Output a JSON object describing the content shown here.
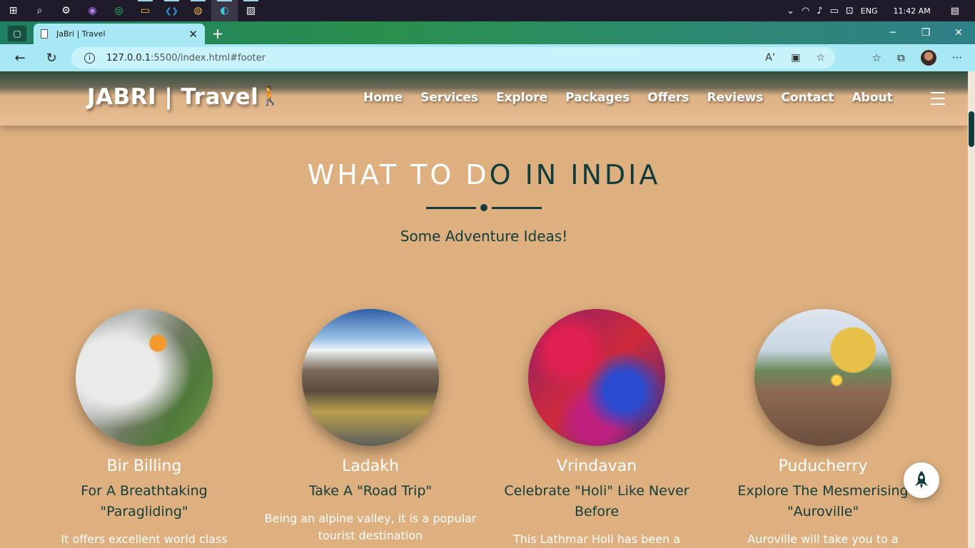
{
  "taskbar": {
    "apps": [
      {
        "icon": "windows-start-icon",
        "glyph": "⊞"
      },
      {
        "icon": "search-icon",
        "glyph": "⌕"
      },
      {
        "icon": "settings-gear-icon",
        "glyph": "⚙"
      },
      {
        "icon": "github-desktop-icon",
        "glyph": "◉"
      },
      {
        "icon": "spotify-icon",
        "glyph": "◎"
      },
      {
        "icon": "file-explorer-icon",
        "glyph": "▭"
      },
      {
        "icon": "vscode-icon",
        "glyph": "❮❯"
      },
      {
        "icon": "chrome-icon",
        "glyph": "◍"
      },
      {
        "icon": "edge-icon",
        "glyph": "◐"
      },
      {
        "icon": "photos-icon",
        "glyph": "▨"
      }
    ],
    "language": "ENG",
    "time": "11:42 AM"
  },
  "browser": {
    "tab_title": "JaBri | Travel",
    "url_host": "127.0.0.1",
    "url_path": ":5500/index.html#footer"
  },
  "site": {
    "logo": "JABRI | Travel",
    "nav": [
      "Home",
      "Services",
      "Explore",
      "Packages",
      "Offers",
      "Reviews",
      "Contact",
      "About"
    ],
    "heading_light": "WHAT TO D",
    "heading_dark": "O IN INDIA",
    "subheading": "Some Adventure Ideas!",
    "cards": [
      {
        "name": "Bir Billing",
        "tag": "For A Breathtaking \"Paragliding\"",
        "desc": "It offers excellent world class"
      },
      {
        "name": "Ladakh",
        "tag": "Take A \"Road Trip\"",
        "desc": "Being an alpine valley, it is a popular tourist destination"
      },
      {
        "name": "Vrindavan",
        "tag": "Celebrate \"Holi\" Like Never Before",
        "desc": "This Lathmar Holi has been a"
      },
      {
        "name": "Puducherry",
        "tag": "Explore The Mesmerising \"Auroville\"",
        "desc": "Auroville will take you to a"
      }
    ]
  }
}
